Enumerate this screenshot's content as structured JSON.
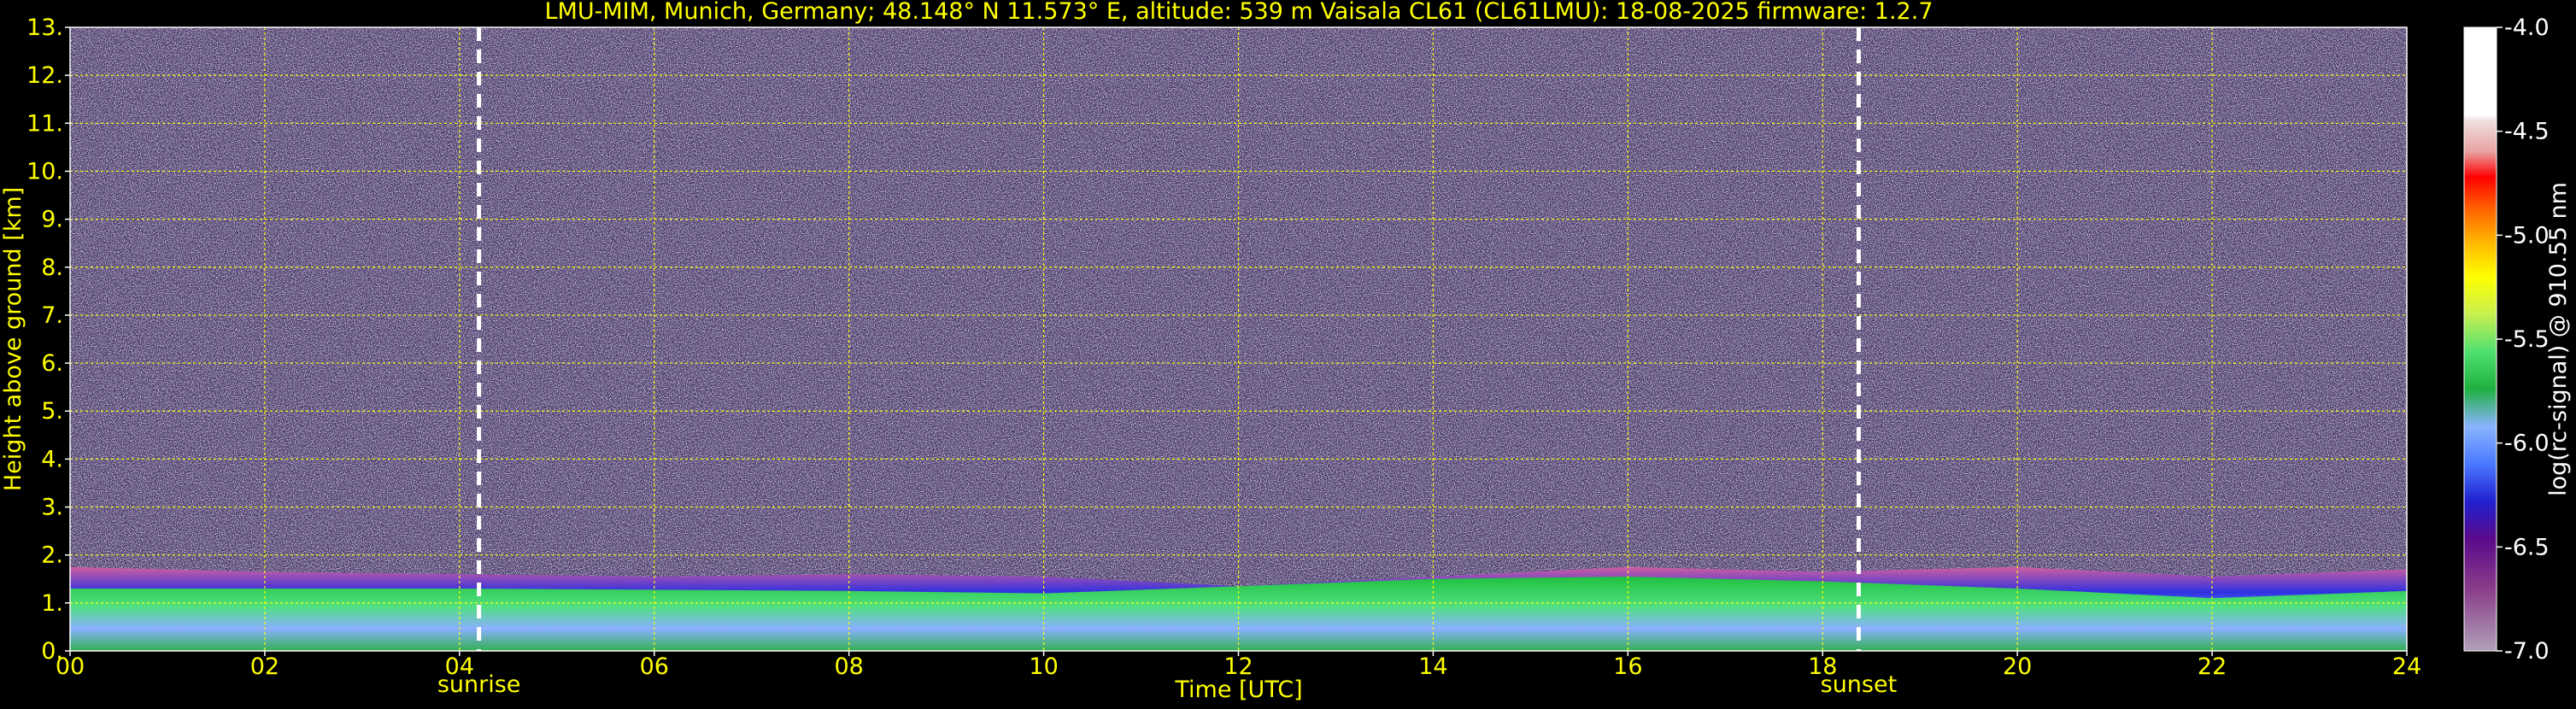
{
  "chart_data": {
    "type": "heatmap",
    "title": "LMU-MIM, Munich, Germany; 48.148° N 11.573° E, altitude: 539 m    Vaisala CL61 (CL61LMU): 18-08-2025    firmware: 1.2.7",
    "xlabel": "Time [UTC]",
    "ylabel": "Height above ground [km]",
    "xlim": [
      0,
      24
    ],
    "ylim": [
      0,
      13
    ],
    "x_ticks": [
      0,
      2,
      4,
      6,
      8,
      10,
      12,
      14,
      16,
      18,
      20,
      22,
      24
    ],
    "x_tick_labels": [
      "00",
      "02",
      "04",
      "06",
      "08",
      "10",
      "12",
      "14",
      "16",
      "18",
      "20",
      "22",
      "24"
    ],
    "y_ticks": [
      0,
      1,
      2,
      3,
      4,
      5,
      6,
      7,
      8,
      9,
      10,
      11,
      12,
      13
    ],
    "y_tick_labels": [
      "0.",
      "1.",
      "2.",
      "3.",
      "4.",
      "5.",
      "6.",
      "7.",
      "8.",
      "9.",
      "10.",
      "11.",
      "12.",
      "13."
    ],
    "grid": true,
    "markers": [
      {
        "label": "sunrise",
        "x": 4.2
      },
      {
        "label": "sunset",
        "x": 18.37
      }
    ],
    "colorbar": {
      "label": "log(rc-signal) @ 910.55 nm",
      "range": [
        -7.0,
        -4.0
      ],
      "ticks": [
        -4.0,
        -4.5,
        -5.0,
        -5.5,
        -6.0,
        -6.5,
        -7.0
      ],
      "tick_labels": [
        "-4.0",
        "-4.5",
        "-5.0",
        "-5.5",
        "-6.0",
        "-6.5",
        "-7.0"
      ]
    },
    "layers": {
      "boundary_layer_top_km": [
        {
          "t": 0,
          "h": 1.75
        },
        {
          "t": 2,
          "h": 1.65
        },
        {
          "t": 4,
          "h": 1.6
        },
        {
          "t": 6,
          "h": 1.55
        },
        {
          "t": 8,
          "h": 1.6
        },
        {
          "t": 10,
          "h": 1.55
        },
        {
          "t": 12,
          "h": 1.35
        },
        {
          "t": 14,
          "h": 1.55
        },
        {
          "t": 16,
          "h": 1.75
        },
        {
          "t": 18,
          "h": 1.65
        },
        {
          "t": 20,
          "h": 1.75
        },
        {
          "t": 22,
          "h": 1.55
        },
        {
          "t": 24,
          "h": 1.7
        }
      ],
      "mixed_layer_top_km": [
        {
          "t": 0,
          "h": 1.3
        },
        {
          "t": 4,
          "h": 1.3
        },
        {
          "t": 8,
          "h": 1.25
        },
        {
          "t": 10,
          "h": 1.2
        },
        {
          "t": 12,
          "h": 1.35
        },
        {
          "t": 14,
          "h": 1.5
        },
        {
          "t": 16,
          "h": 1.55
        },
        {
          "t": 18,
          "h": 1.45
        },
        {
          "t": 20,
          "h": 1.3
        },
        {
          "t": 22,
          "h": 1.1
        },
        {
          "t": 24,
          "h": 1.25
        }
      ]
    },
    "colors": {
      "background": "#000000",
      "text": "#ffff00",
      "grid": "#ffff00",
      "noise": "#5a4a7a",
      "marker_line": "#ffffff"
    }
  }
}
